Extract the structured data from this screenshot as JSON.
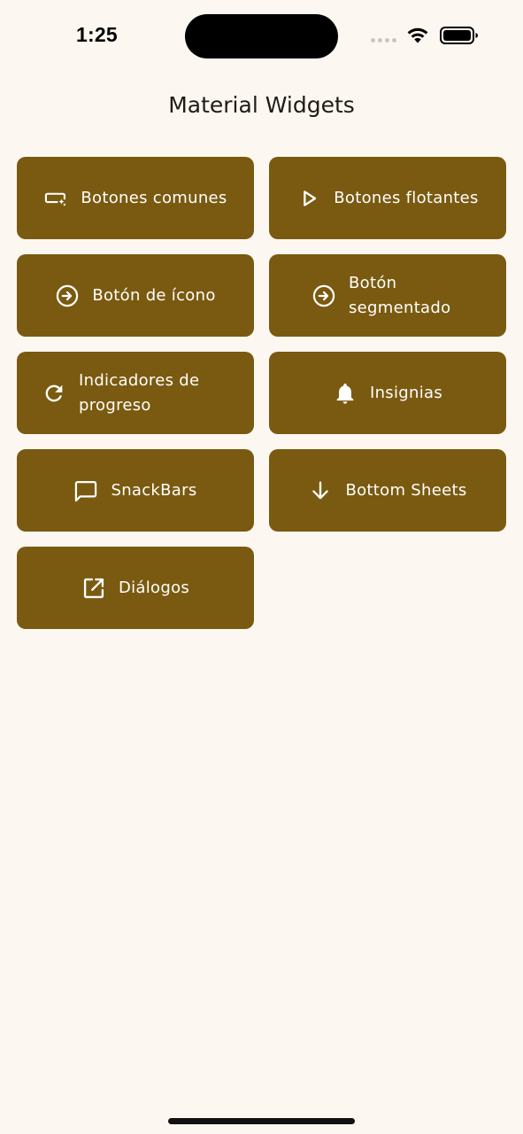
{
  "status_bar": {
    "time": "1:25",
    "icons": [
      "signal-icon",
      "wifi-icon",
      "battery-icon"
    ]
  },
  "app_bar": {
    "title": "Material Widgets"
  },
  "colors": {
    "background": "#fcf7f1",
    "tile": "#7a5a10",
    "tile_text": "#ffffff"
  },
  "tiles": [
    {
      "label": "Botones comunes",
      "icon": "smart-button-icon"
    },
    {
      "label": "Botones flotantes",
      "icon": "play-outline-icon"
    },
    {
      "label": "Botón de ícono",
      "icon": "arrow-circle-right-icon"
    },
    {
      "label": "Botón segmentado",
      "icon": "arrow-circle-right-icon"
    },
    {
      "label": "Indicadores de progreso",
      "icon": "refresh-icon"
    },
    {
      "label": "Insignias",
      "icon": "bell-icon"
    },
    {
      "label": "SnackBars",
      "icon": "chat-bubble-icon"
    },
    {
      "label": "Bottom Sheets",
      "icon": "arrow-down-icon"
    },
    {
      "label": "Diálogos",
      "icon": "open-in-new-icon"
    }
  ]
}
